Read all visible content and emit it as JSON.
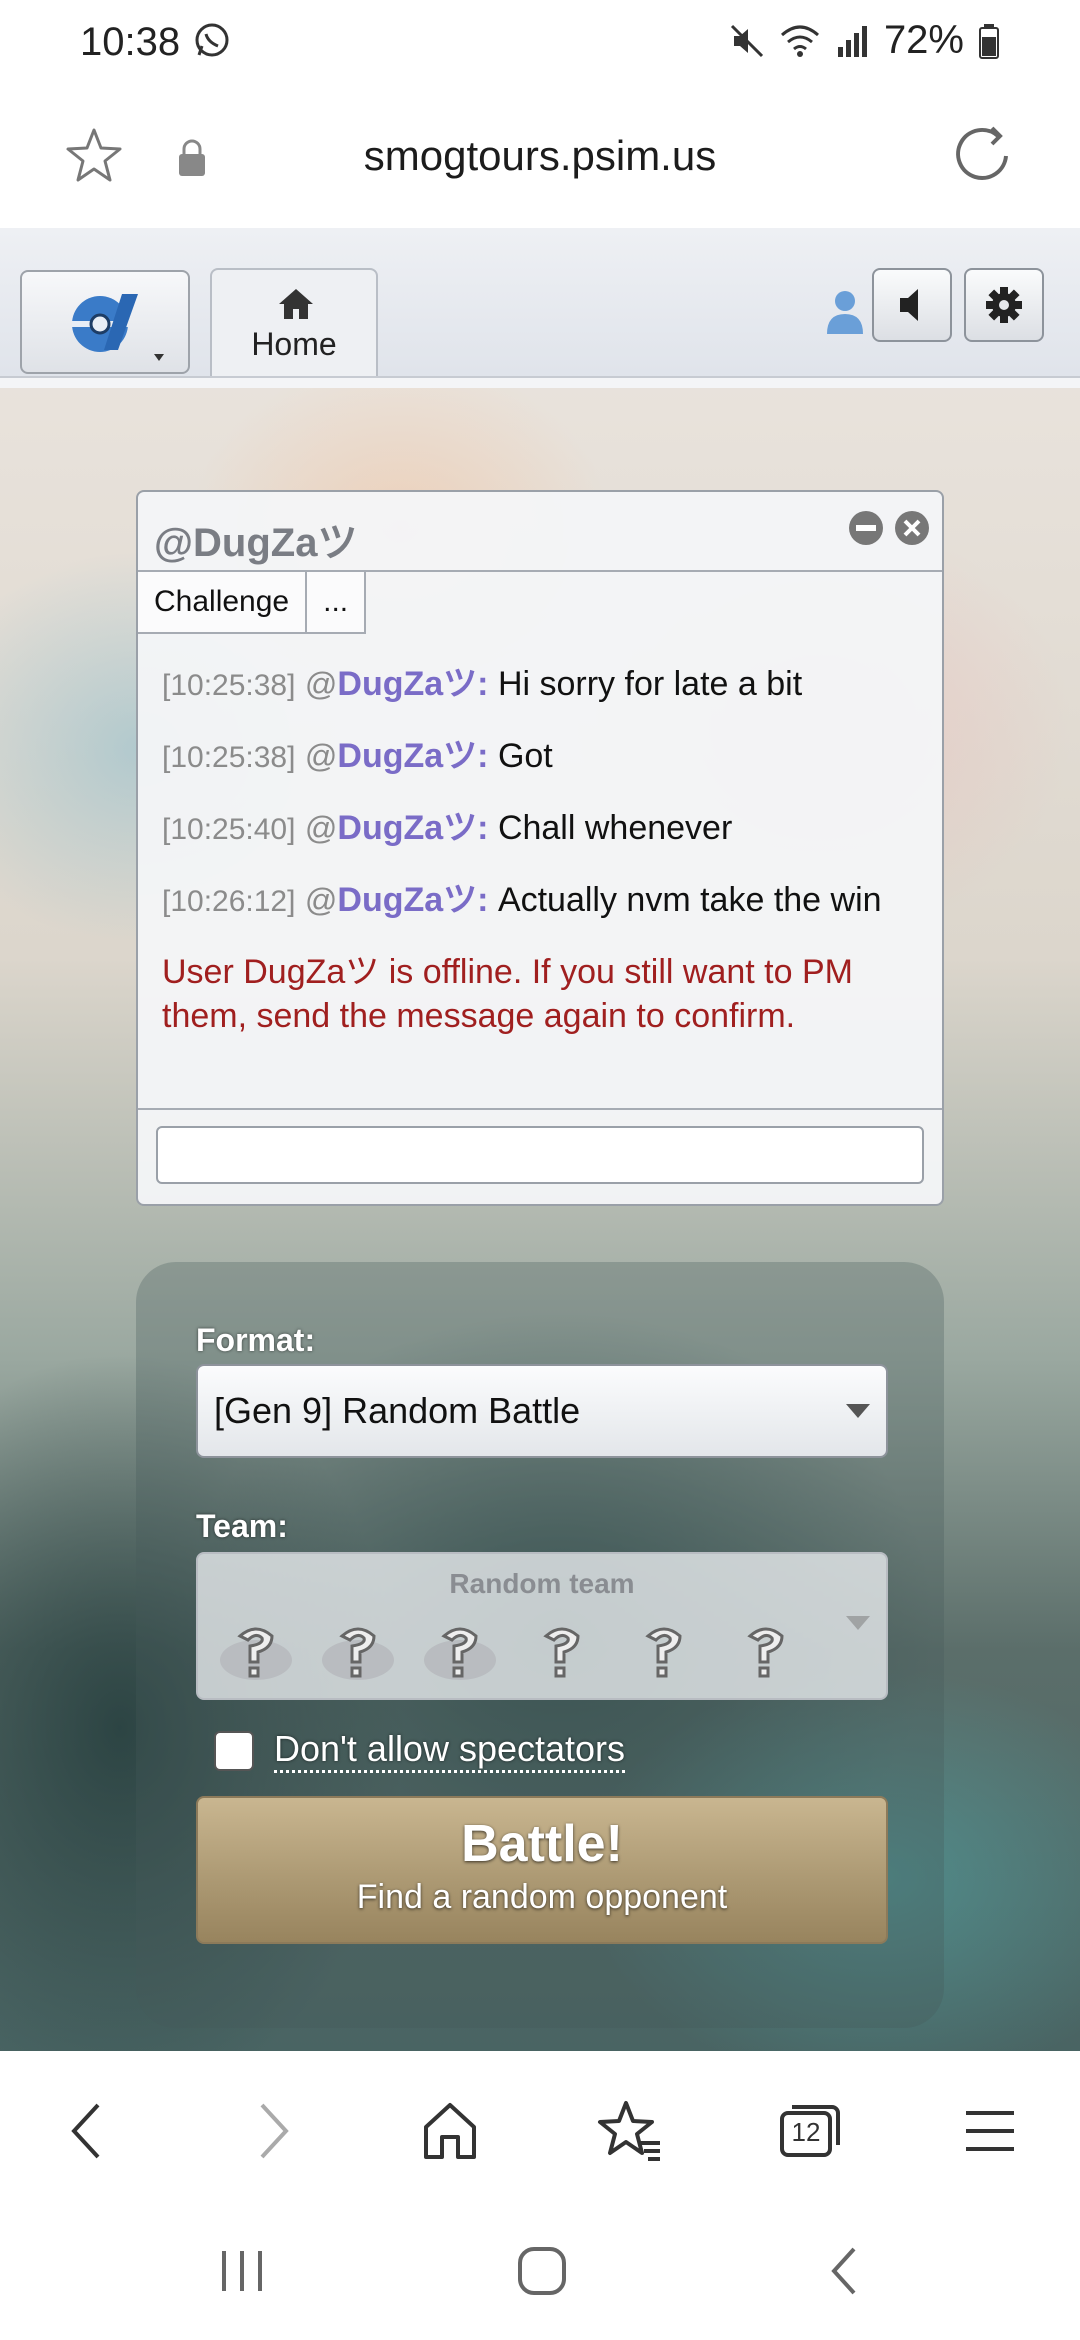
{
  "status_bar": {
    "time": "10:38",
    "battery": "72%",
    "icons": [
      "whatsapp-icon",
      "mute-icon",
      "wifi-icon",
      "signal-icon",
      "battery-icon"
    ]
  },
  "browser": {
    "url": "smogtours.psim.us",
    "tab_count": "12",
    "icons": [
      "bookmark-star-icon",
      "lock-icon",
      "reload-icon"
    ]
  },
  "header": {
    "home_tab": "Home",
    "icons": [
      "showdown-logo-icon",
      "home-icon",
      "user-icon",
      "volume-icon",
      "gear-icon"
    ]
  },
  "pm": {
    "title": "@DugZaツ",
    "tabs": [
      "Challenge",
      "..."
    ],
    "messages": [
      {
        "time": "[10:25:38]",
        "prefix": "@",
        "user": "DugZaツ:",
        "text": "Hi sorry for late a bit"
      },
      {
        "time": "[10:25:38]",
        "prefix": "@",
        "user": "DugZaツ:",
        "text": "Got"
      },
      {
        "time": "[10:25:40]",
        "prefix": "@",
        "user": "DugZaツ:",
        "text": "Chall whenever"
      },
      {
        "time": "[10:26:12]",
        "prefix": "@",
        "user": "DugZaツ:",
        "text": "Actually nvm take the win"
      }
    ],
    "offline_notice": "User DugZaツ is offline. If you still want to PM them, send the message again to confirm.",
    "input_value": ""
  },
  "battle_form": {
    "format_label": "Format:",
    "format_value": "[Gen 9] Random Battle",
    "team_label": "Team:",
    "team_value": "Random team",
    "spectators_label": "Don't allow spectators",
    "spectators_checked": false,
    "battle_button": "Battle!",
    "battle_subtitle": "Find a random opponent"
  },
  "bottom_bar": {
    "icons": [
      "back-icon",
      "forward-icon",
      "home-icon",
      "bookmarks-icon",
      "tabs-icon",
      "menu-icon"
    ]
  },
  "nav_bar": {
    "icons": [
      "recents-icon",
      "home-icon",
      "back-icon"
    ]
  }
}
